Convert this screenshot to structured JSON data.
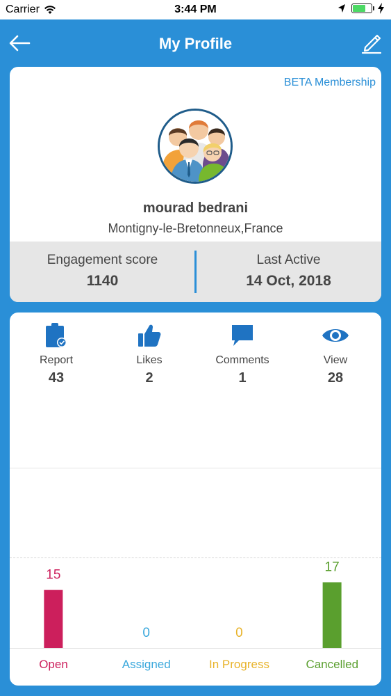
{
  "status_bar": {
    "carrier": "Carrier",
    "time": "3:44 PM"
  },
  "header": {
    "title": "My Profile"
  },
  "profile": {
    "membership": "BETA Membership",
    "name": "mourad bedrani",
    "location": "Montigny-le-Bretonneux,France",
    "engagement_label": "Engagement score",
    "engagement_value": "1140",
    "last_active_label": "Last Active",
    "last_active_value": "14 Oct, 2018"
  },
  "activities": [
    {
      "label": "Report",
      "count": "43",
      "icon": "clipboard-check-icon"
    },
    {
      "label": "Likes",
      "count": "2",
      "icon": "thumbs-up-icon"
    },
    {
      "label": "Comments",
      "count": "1",
      "icon": "comment-icon"
    },
    {
      "label": "View",
      "count": "28",
      "icon": "eye-icon"
    }
  ],
  "colors": {
    "primary": "#2a8fd7",
    "open": "#cc1f5c",
    "assigned": "#3aa8dc",
    "in_progress": "#e8b32a",
    "cancelled": "#5a9f2e"
  },
  "chart_data": {
    "type": "bar",
    "categories": [
      "Open",
      "Assigned",
      "In Progress",
      "Cancelled"
    ],
    "values": [
      15,
      0,
      0,
      17
    ],
    "colors": [
      "#cc1f5c",
      "#3aa8dc",
      "#e8b32a",
      "#5a9f2e"
    ],
    "data_labels": [
      "15",
      "0",
      "0",
      "17"
    ],
    "ylim": [
      0,
      45
    ],
    "grid": true
  }
}
